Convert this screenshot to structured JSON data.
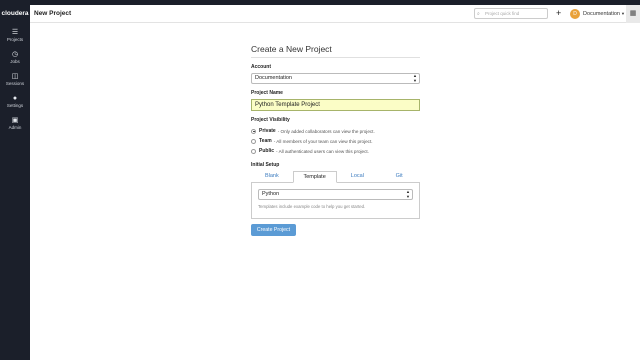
{
  "header": {
    "brand": "cloudera",
    "page_title": "New Project",
    "search_placeholder": "Project quick find",
    "plus": "+",
    "user_initial": "D",
    "user_name": "Documentation"
  },
  "sidebar": {
    "items": [
      {
        "label": "Projects",
        "icon": "projects-icon"
      },
      {
        "label": "Jobs",
        "icon": "jobs-icon"
      },
      {
        "label": "Sessions",
        "icon": "sessions-icon"
      },
      {
        "label": "Settings",
        "icon": "settings-icon"
      },
      {
        "label": "Admin",
        "icon": "admin-icon"
      }
    ]
  },
  "form": {
    "title": "Create a New Project",
    "account_label": "Account",
    "account_value": "Documentation",
    "name_label": "Project Name",
    "name_value": "Python Template Project",
    "visibility_label": "Project Visibility",
    "visibility": [
      {
        "title": "Private",
        "desc": "- Only added collaborators can view the project.",
        "selected": true
      },
      {
        "title": "Team",
        "desc": "- All members of your team can view this project.",
        "selected": false
      },
      {
        "title": "Public",
        "desc": "- All authenticated users can view this project.",
        "selected": false
      }
    ],
    "setup_label": "Initial Setup",
    "tabs": [
      "Blank",
      "Template",
      "Local",
      "Git"
    ],
    "active_tab": "Template",
    "template_value": "Python",
    "template_hint": "Templates include example code to help you get started.",
    "submit_label": "Create Project"
  },
  "colors": {
    "sidebar_bg": "#1b1f2a",
    "accent_button": "#5b9bd5",
    "field_highlight": "#fbfdc6",
    "avatar": "#e9a23b"
  }
}
